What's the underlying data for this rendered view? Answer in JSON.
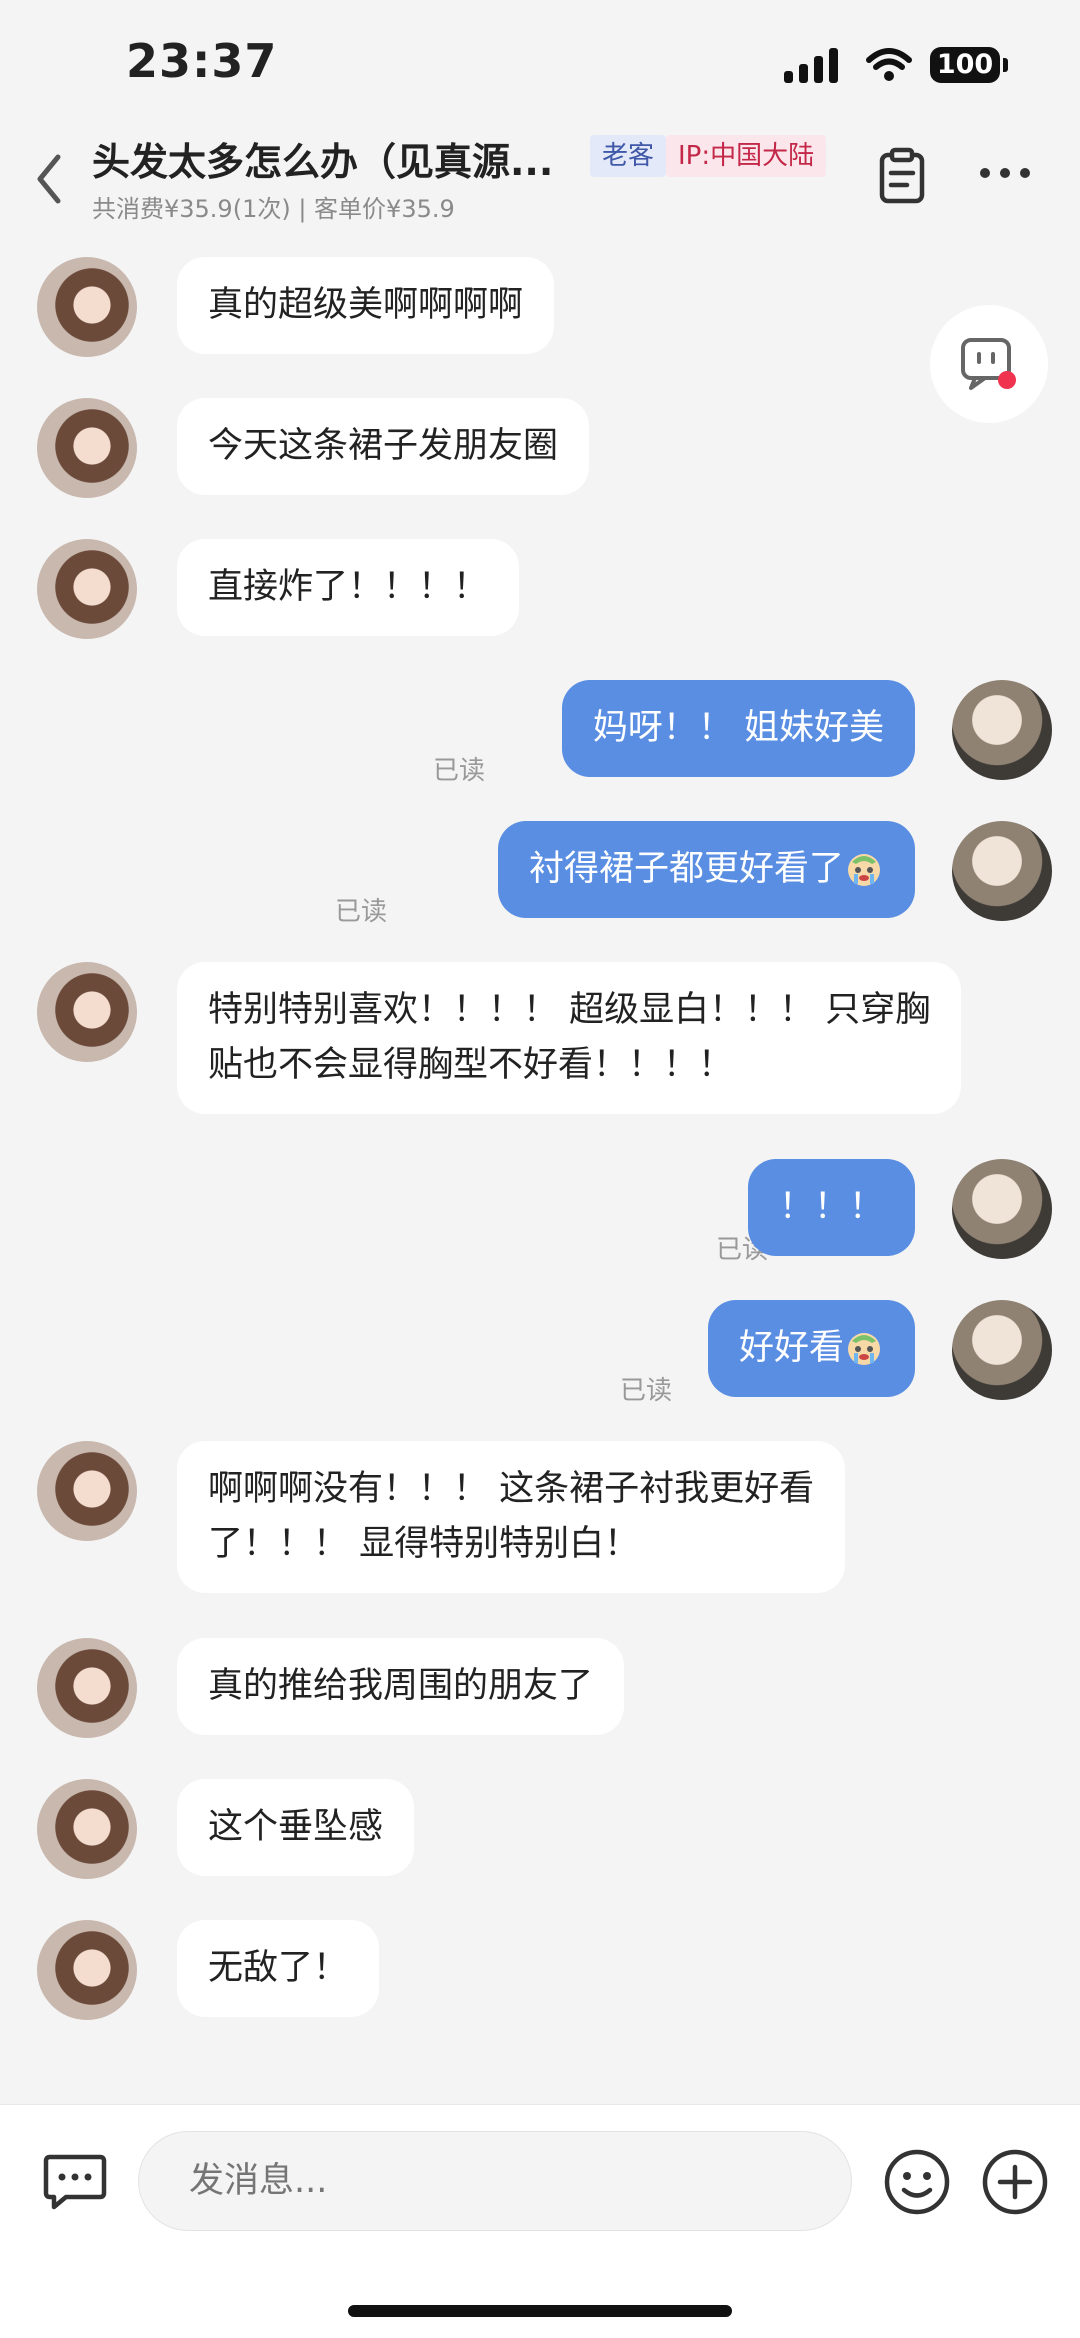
{
  "status_bar": {
    "time": "23:37",
    "battery": "100"
  },
  "header": {
    "title": "头发太多怎么办（见真源...",
    "badge_old": "老客",
    "badge_ip": "IP:中国大陆",
    "subtitle": "共消费¥35.9(1次) | 客单价¥35.9"
  },
  "messages": {
    "m1": "真的超级美啊啊啊啊",
    "m2": "今天这条裙子发朋友圈",
    "m3": "直接炸了！！！！",
    "m4": "妈呀！！ 姐妹好美",
    "m5": "衬得裙子都更好看了",
    "m6_line1": "特别特别喜欢！！！！ 超级显白！！！ 只穿胸",
    "m6_line2": "贴也不会显得胸型不好看！！！！",
    "m7": "！！！",
    "m8": "好好看",
    "m9_line1": "啊啊啊没有！！！ 这条裙子衬我更好看",
    "m9_line2": "了！！！ 显得特别特别白！",
    "m10": "真的推给我周围的朋友了",
    "m11": "这个垂坠感",
    "m12": "无敌了！"
  },
  "read_label": "已读",
  "input": {
    "placeholder": "发消息..."
  },
  "icons": {
    "back": "chevron-left-icon",
    "clipboard": "clipboard-icon",
    "more": "more-dots-icon",
    "assistant": "robot-assistant-icon",
    "keyboard": "chat-keyboard-icon",
    "emoji": "smiley-icon",
    "plus": "plus-circle-icon"
  },
  "colors": {
    "outgoing_bubble": "#5a8ee3",
    "badge_ip": "#c42848",
    "badge_old": "#3f58a8",
    "notification_dot": "#f0334f"
  }
}
